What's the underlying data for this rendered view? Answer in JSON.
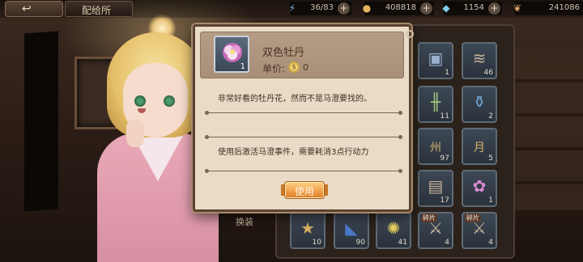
{
  "topbar": {
    "title": "配给所",
    "resources": [
      {
        "icon": "energy-icon",
        "value": "36/83"
      },
      {
        "icon": "gold-coin-icon",
        "value": "408818"
      },
      {
        "icon": "diamond-icon",
        "value": "1154"
      },
      {
        "icon": "feather-icon",
        "value": "241086"
      }
    ],
    "plus_label": "+"
  },
  "dialog": {
    "item_name": "双色牡丹",
    "item_qty": "1",
    "price_label": "单价:",
    "price_value": "0",
    "description": "非常好看的牡丹花，然而不是马澄要找的。",
    "usage": "使用后激活马澄事件，需要耗消3点行动力",
    "use_button": "使用"
  },
  "inventory": {
    "swap_label": "换装",
    "cells": [
      {
        "icon": "gift-box-icon",
        "count": "1",
        "tag": ""
      },
      {
        "icon": "scroll-icon",
        "count": "46",
        "tag": ""
      },
      {
        "icon": "ladder-icon",
        "count": "11",
        "tag": ""
      },
      {
        "icon": "ink-jar-icon",
        "count": "2",
        "tag": ""
      },
      {
        "icon": "mooncake-zhou-icon",
        "count": "97",
        "tag": "",
        "glyph": "州"
      },
      {
        "icon": "mooncake-yue-icon",
        "count": "5",
        "tag": "",
        "glyph": "月"
      },
      {
        "icon": "document-icon",
        "count": "17",
        "tag": ""
      },
      {
        "icon": "peony-flower-icon",
        "count": "1",
        "tag": ""
      },
      {
        "icon": "star-icon",
        "count": "10",
        "tag": ""
      },
      {
        "icon": "blue-cloth-icon",
        "count": "90",
        "tag": ""
      },
      {
        "icon": "firework-icon",
        "count": "41",
        "tag": ""
      },
      {
        "icon": "shard-icon",
        "count": "4",
        "tag": "碎片"
      },
      {
        "icon": "shard-icon",
        "count": "4",
        "tag": "碎片"
      }
    ]
  }
}
